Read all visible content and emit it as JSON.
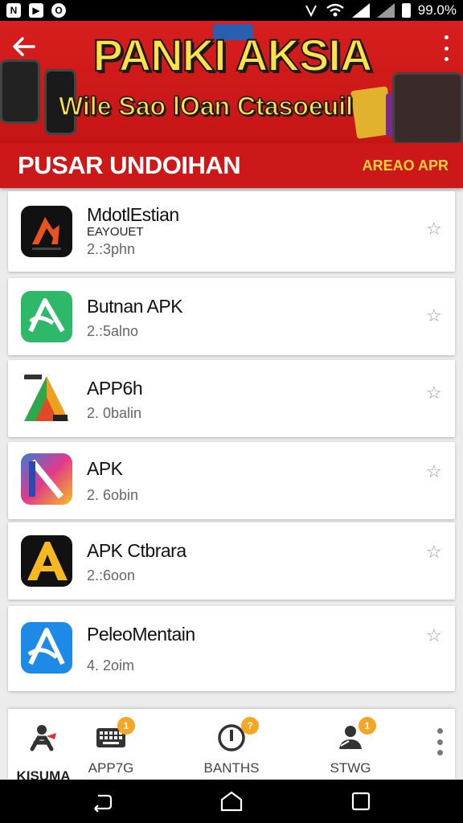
{
  "status_bar": {
    "battery_text": "99.0%",
    "icons": [
      "n-notification-icon",
      "media-notification-icon",
      "circle-notification-icon",
      "nfc-icon",
      "wifi-icon",
      "signal-icon",
      "signal-icon",
      "battery-icon"
    ]
  },
  "header": {
    "back_icon": "arrow-left-icon",
    "banner_title": "PANKI AKSIA",
    "banner_subtitle": "Wile Sao lOan Ctasoeuil",
    "menu_icon": "more-vertical-icon",
    "colors": {
      "background": "#d81e1e",
      "title": "#ffe14a"
    }
  },
  "section": {
    "title": "PUSAR UNDOIHAN",
    "link": "AREAO APR",
    "colors": {
      "background": "#cc1818",
      "link": "#ffd23a"
    }
  },
  "apps": [
    {
      "name": "MdotlEstian",
      "sub": "EAYOUET",
      "meta": "2.:3phn",
      "icon": "flame-logo-icon",
      "star": "star-outline-icon"
    },
    {
      "name": "Butnan APK",
      "sub": "",
      "meta": "2.:5alno",
      "icon": "green-a-logo-icon",
      "star": "star-outline-icon"
    },
    {
      "name": "APP6h",
      "sub": "",
      "meta": "2. 0balin",
      "icon": "multicolor-a-logo-icon",
      "star": "star-outline-icon"
    },
    {
      "name": "APK",
      "sub": "",
      "meta": "2. 6obin",
      "icon": "gradient-a-logo-icon",
      "star": "star-outline-icon"
    },
    {
      "name": "APK Ctbrara",
      "sub": "",
      "meta": "2.:6oon",
      "icon": "yellow-a-logo-icon",
      "star": "star-outline-icon"
    },
    {
      "name": "PeleoMentain",
      "sub": "",
      "meta": "4. 2oim",
      "icon": "blue-a-logo-icon",
      "star": "star-outline-icon"
    }
  ],
  "bottom_nav": {
    "items": [
      {
        "label": "KISUMA",
        "icon": "person-icon",
        "badge": ""
      },
      {
        "label": "APP7G",
        "icon": "keyboard-icon",
        "badge": "1"
      },
      {
        "label": "BANTHS",
        "icon": "timer-icon",
        "badge": "?"
      },
      {
        "label": "STWG",
        "icon": "user-settings-icon",
        "badge": "1"
      }
    ],
    "more_icon": "more-vertical-icon",
    "badge_color": "#f5a623"
  },
  "system_nav": {
    "back_icon": "back-icon",
    "home_icon": "home-icon",
    "recents_icon": "recents-icon"
  }
}
